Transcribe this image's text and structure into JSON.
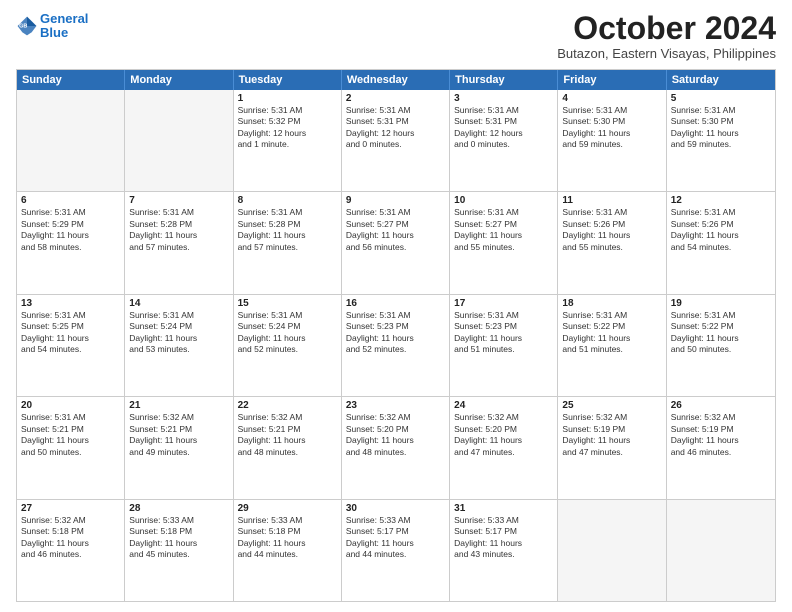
{
  "header": {
    "logo_line1": "General",
    "logo_line2": "Blue",
    "month": "October 2024",
    "location": "Butazon, Eastern Visayas, Philippines"
  },
  "weekdays": [
    "Sunday",
    "Monday",
    "Tuesday",
    "Wednesday",
    "Thursday",
    "Friday",
    "Saturday"
  ],
  "rows": [
    [
      {
        "day": "",
        "text": ""
      },
      {
        "day": "",
        "text": ""
      },
      {
        "day": "1",
        "text": "Sunrise: 5:31 AM\nSunset: 5:32 PM\nDaylight: 12 hours\nand 1 minute."
      },
      {
        "day": "2",
        "text": "Sunrise: 5:31 AM\nSunset: 5:31 PM\nDaylight: 12 hours\nand 0 minutes."
      },
      {
        "day": "3",
        "text": "Sunrise: 5:31 AM\nSunset: 5:31 PM\nDaylight: 12 hours\nand 0 minutes."
      },
      {
        "day": "4",
        "text": "Sunrise: 5:31 AM\nSunset: 5:30 PM\nDaylight: 11 hours\nand 59 minutes."
      },
      {
        "day": "5",
        "text": "Sunrise: 5:31 AM\nSunset: 5:30 PM\nDaylight: 11 hours\nand 59 minutes."
      }
    ],
    [
      {
        "day": "6",
        "text": "Sunrise: 5:31 AM\nSunset: 5:29 PM\nDaylight: 11 hours\nand 58 minutes."
      },
      {
        "day": "7",
        "text": "Sunrise: 5:31 AM\nSunset: 5:28 PM\nDaylight: 11 hours\nand 57 minutes."
      },
      {
        "day": "8",
        "text": "Sunrise: 5:31 AM\nSunset: 5:28 PM\nDaylight: 11 hours\nand 57 minutes."
      },
      {
        "day": "9",
        "text": "Sunrise: 5:31 AM\nSunset: 5:27 PM\nDaylight: 11 hours\nand 56 minutes."
      },
      {
        "day": "10",
        "text": "Sunrise: 5:31 AM\nSunset: 5:27 PM\nDaylight: 11 hours\nand 55 minutes."
      },
      {
        "day": "11",
        "text": "Sunrise: 5:31 AM\nSunset: 5:26 PM\nDaylight: 11 hours\nand 55 minutes."
      },
      {
        "day": "12",
        "text": "Sunrise: 5:31 AM\nSunset: 5:26 PM\nDaylight: 11 hours\nand 54 minutes."
      }
    ],
    [
      {
        "day": "13",
        "text": "Sunrise: 5:31 AM\nSunset: 5:25 PM\nDaylight: 11 hours\nand 54 minutes."
      },
      {
        "day": "14",
        "text": "Sunrise: 5:31 AM\nSunset: 5:24 PM\nDaylight: 11 hours\nand 53 minutes."
      },
      {
        "day": "15",
        "text": "Sunrise: 5:31 AM\nSunset: 5:24 PM\nDaylight: 11 hours\nand 52 minutes."
      },
      {
        "day": "16",
        "text": "Sunrise: 5:31 AM\nSunset: 5:23 PM\nDaylight: 11 hours\nand 52 minutes."
      },
      {
        "day": "17",
        "text": "Sunrise: 5:31 AM\nSunset: 5:23 PM\nDaylight: 11 hours\nand 51 minutes."
      },
      {
        "day": "18",
        "text": "Sunrise: 5:31 AM\nSunset: 5:22 PM\nDaylight: 11 hours\nand 51 minutes."
      },
      {
        "day": "19",
        "text": "Sunrise: 5:31 AM\nSunset: 5:22 PM\nDaylight: 11 hours\nand 50 minutes."
      }
    ],
    [
      {
        "day": "20",
        "text": "Sunrise: 5:31 AM\nSunset: 5:21 PM\nDaylight: 11 hours\nand 50 minutes."
      },
      {
        "day": "21",
        "text": "Sunrise: 5:32 AM\nSunset: 5:21 PM\nDaylight: 11 hours\nand 49 minutes."
      },
      {
        "day": "22",
        "text": "Sunrise: 5:32 AM\nSunset: 5:21 PM\nDaylight: 11 hours\nand 48 minutes."
      },
      {
        "day": "23",
        "text": "Sunrise: 5:32 AM\nSunset: 5:20 PM\nDaylight: 11 hours\nand 48 minutes."
      },
      {
        "day": "24",
        "text": "Sunrise: 5:32 AM\nSunset: 5:20 PM\nDaylight: 11 hours\nand 47 minutes."
      },
      {
        "day": "25",
        "text": "Sunrise: 5:32 AM\nSunset: 5:19 PM\nDaylight: 11 hours\nand 47 minutes."
      },
      {
        "day": "26",
        "text": "Sunrise: 5:32 AM\nSunset: 5:19 PM\nDaylight: 11 hours\nand 46 minutes."
      }
    ],
    [
      {
        "day": "27",
        "text": "Sunrise: 5:32 AM\nSunset: 5:18 PM\nDaylight: 11 hours\nand 46 minutes."
      },
      {
        "day": "28",
        "text": "Sunrise: 5:33 AM\nSunset: 5:18 PM\nDaylight: 11 hours\nand 45 minutes."
      },
      {
        "day": "29",
        "text": "Sunrise: 5:33 AM\nSunset: 5:18 PM\nDaylight: 11 hours\nand 44 minutes."
      },
      {
        "day": "30",
        "text": "Sunrise: 5:33 AM\nSunset: 5:17 PM\nDaylight: 11 hours\nand 44 minutes."
      },
      {
        "day": "31",
        "text": "Sunrise: 5:33 AM\nSunset: 5:17 PM\nDaylight: 11 hours\nand 43 minutes."
      },
      {
        "day": "",
        "text": ""
      },
      {
        "day": "",
        "text": ""
      }
    ]
  ]
}
